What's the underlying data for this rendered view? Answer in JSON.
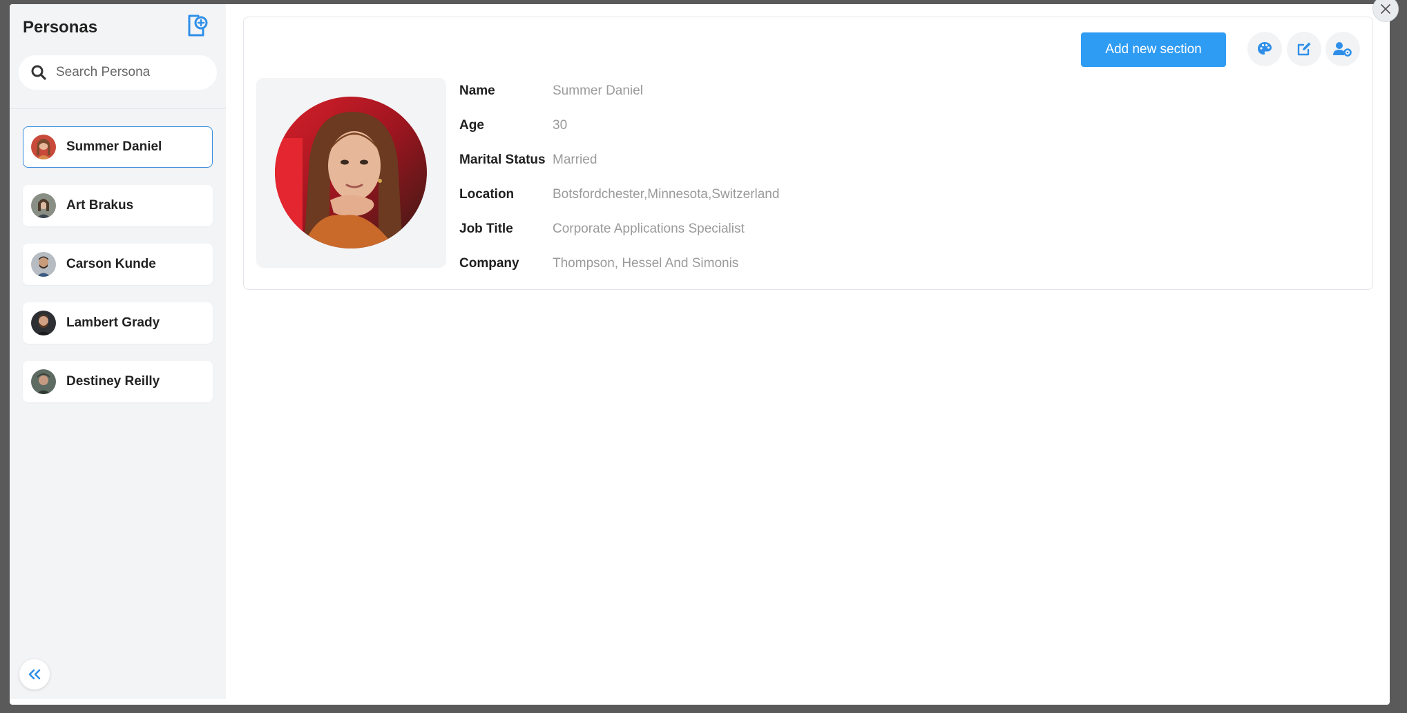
{
  "sidebar": {
    "title": "Personas",
    "search_placeholder": "Search Persona",
    "personas": [
      {
        "name": "Summer Daniel",
        "selected": true
      },
      {
        "name": "Art Brakus",
        "selected": false
      },
      {
        "name": "Carson Kunde",
        "selected": false
      },
      {
        "name": "Lambert Grady",
        "selected": false
      },
      {
        "name": "Destiney Reilly",
        "selected": false
      }
    ]
  },
  "toolbar": {
    "add_section_label": "Add new section",
    "icons": [
      "palette-icon",
      "edit-icon",
      "user-settings-icon"
    ]
  },
  "profile": {
    "fields": [
      {
        "label": "Name",
        "value": "Summer Daniel"
      },
      {
        "label": "Age",
        "value": "30"
      },
      {
        "label": "Marital Status",
        "value": "Married"
      },
      {
        "label": "Location",
        "value": "Botsfordchester,Minnesota,Switzerland"
      },
      {
        "label": "Job Title",
        "value": "Corporate Applications Specialist"
      },
      {
        "label": "Company",
        "value": "Thompson, Hessel And Simonis"
      }
    ]
  },
  "colors": {
    "accent": "#2f9cf4",
    "selected_border": "#3b8fe0",
    "sidebar_bg": "#f3f4f6"
  }
}
